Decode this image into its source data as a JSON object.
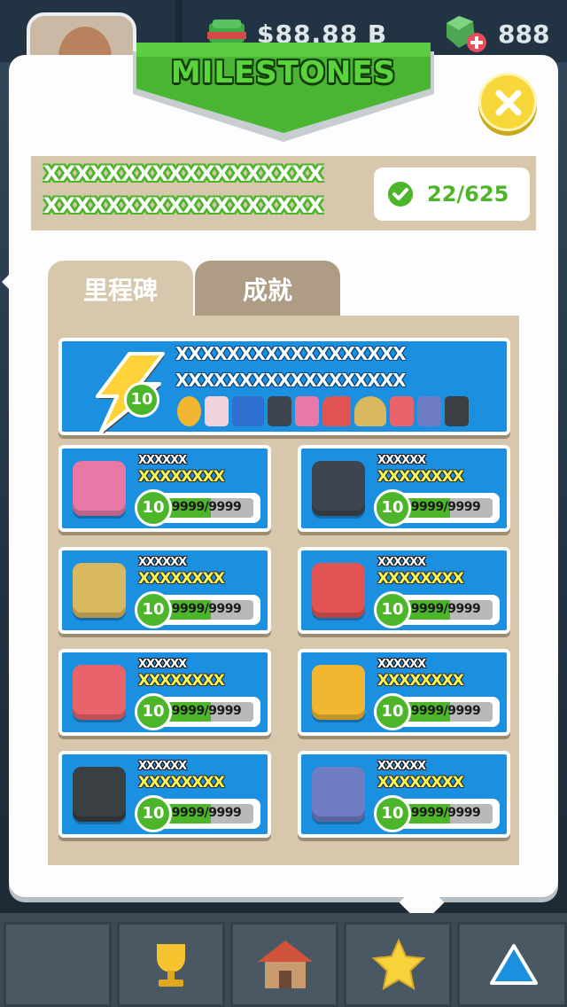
{
  "hud": {
    "money": "$88.88",
    "money_suffix": "B",
    "gems": "888"
  },
  "panel": {
    "title": "MILESTONES",
    "summary_line1": "XXXXXXXXXXXXXXXXXX",
    "summary_line2": "XXXXXXXXXXXXXXXXXX",
    "progress_count": "22/625"
  },
  "tabs": [
    {
      "label": "里程碑",
      "active": true
    },
    {
      "label": "成就",
      "active": false
    }
  ],
  "feature": {
    "line1": "XXXXXXXXXXXXXXXXXX",
    "line2": "XXXXXXXXXXXXXXXXXX",
    "level": "10",
    "icons": [
      "ring-icon",
      "easel-icon",
      "car-icon",
      "speaker-icon",
      "book-icon",
      "sneaker-icon",
      "lamp-icon",
      "shirt-icon",
      "washer-icon",
      "monitor-icon"
    ]
  },
  "milestones": [
    {
      "icon": "book-icon",
      "name": "XXXXXX",
      "sub": "XXXXXXXX",
      "level": "10",
      "progress": "9999/9999",
      "fill": 0.55,
      "color": "#e879a6"
    },
    {
      "icon": "speaker-icon",
      "name": "XXXXXX",
      "sub": "XXXXXXXX",
      "level": "10",
      "progress": "9999/9999",
      "fill": 0.55,
      "color": "#3d4650"
    },
    {
      "icon": "lamp-icon",
      "name": "XXXXXX",
      "sub": "XXXXXXXX",
      "level": "10",
      "progress": "9999/9999",
      "fill": 0.55,
      "color": "#d9b860"
    },
    {
      "icon": "sneaker-icon",
      "name": "XXXXXX",
      "sub": "XXXXXXXX",
      "level": "10",
      "progress": "9999/9999",
      "fill": 0.55,
      "color": "#e25454"
    },
    {
      "icon": "shirt-icon",
      "name": "XXXXXX",
      "sub": "XXXXXXXX",
      "level": "10",
      "progress": "9999/9999",
      "fill": 0.55,
      "color": "#e9636b"
    },
    {
      "icon": "ring-icon",
      "name": "XXXXXX",
      "sub": "XXXXXXXX",
      "level": "10",
      "progress": "9999/9999",
      "fill": 0.55,
      "color": "#f2b631"
    },
    {
      "icon": "monitor-icon",
      "name": "XXXXXX",
      "sub": "XXXXXXXX",
      "level": "10",
      "progress": "9999/9999",
      "fill": 0.55,
      "color": "#3a3f44"
    },
    {
      "icon": "washer-icon",
      "name": "XXXXXX",
      "sub": "XXXXXXXX",
      "level": "10",
      "progress": "9999/9999",
      "fill": 0.55,
      "color": "#6f7dc4"
    }
  ],
  "bottom_nav": [
    {
      "icon": "trophy-icon"
    },
    {
      "icon": "house-icon"
    },
    {
      "icon": "star-icon"
    },
    {
      "icon": "triangle-icon"
    }
  ]
}
